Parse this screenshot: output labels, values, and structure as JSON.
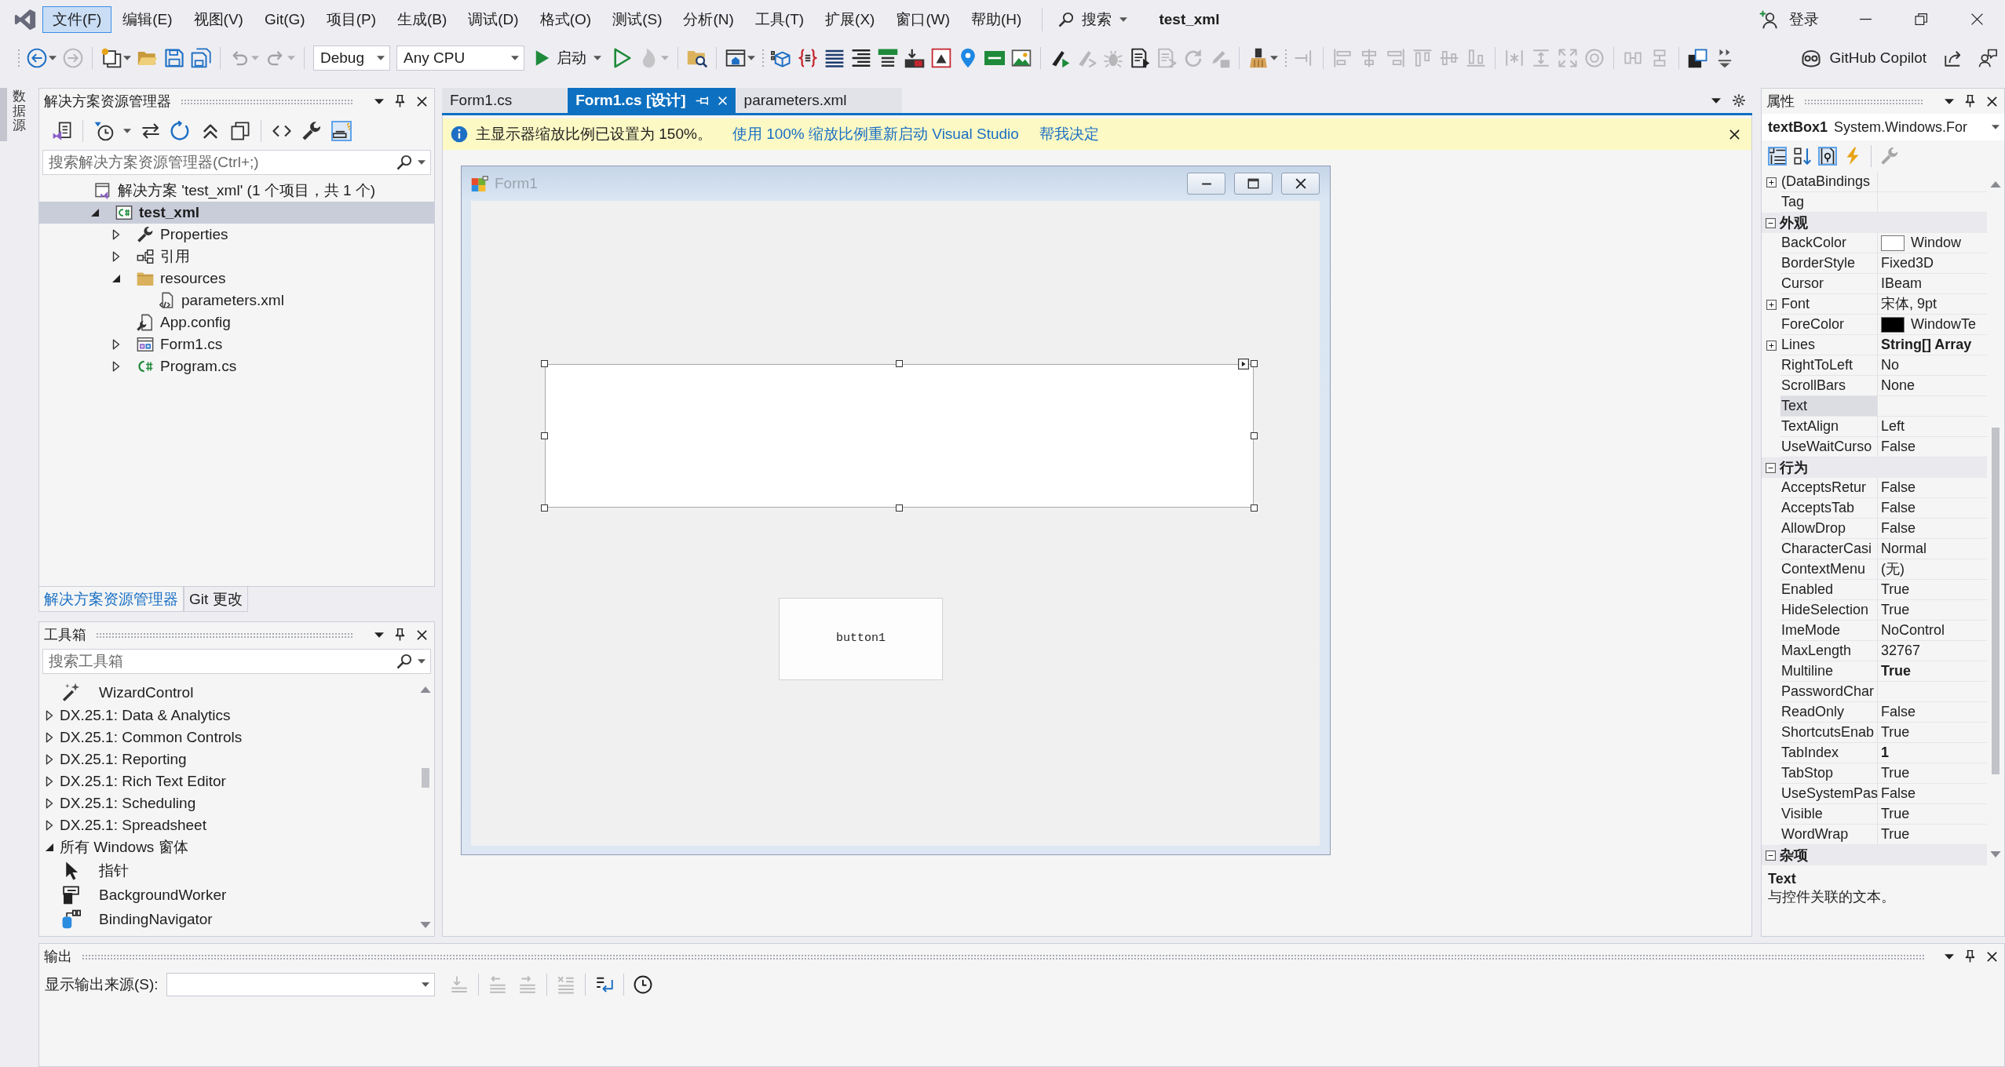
{
  "window": {
    "title": "test_xml",
    "search": "搜索",
    "sign_in": "登录"
  },
  "menu": [
    {
      "label": "文件(F)",
      "selected": true
    },
    {
      "label": "编辑(E)",
      "selected": false
    },
    {
      "label": "视图(V)",
      "selected": false
    },
    {
      "label": "Git(G)",
      "selected": false
    },
    {
      "label": "项目(P)",
      "selected": false
    },
    {
      "label": "生成(B)",
      "selected": false
    },
    {
      "label": "调试(D)",
      "selected": false
    },
    {
      "label": "格式(O)",
      "selected": false
    },
    {
      "label": "测试(S)",
      "selected": false
    },
    {
      "label": "分析(N)",
      "selected": false
    },
    {
      "label": "工具(T)",
      "selected": false
    },
    {
      "label": "扩展(X)",
      "selected": false
    },
    {
      "label": "窗口(W)",
      "selected": false
    },
    {
      "label": "帮助(H)",
      "selected": false
    }
  ],
  "toolbar": [
    {
      "kind": "grip"
    },
    {
      "kind": "back",
      "disabled": false,
      "caret": true
    },
    {
      "kind": "forward",
      "disabled": true
    },
    {
      "kind": "sep"
    },
    {
      "kind": "new-item",
      "disabled": false,
      "caret": true
    },
    {
      "kind": "open",
      "disabled": false
    },
    {
      "kind": "save",
      "disabled": false
    },
    {
      "kind": "save-all",
      "disabled": false
    },
    {
      "kind": "sep"
    },
    {
      "kind": "undo",
      "disabled": true,
      "caret": true
    },
    {
      "kind": "redo",
      "disabled": true,
      "caret": true
    },
    {
      "kind": "sep"
    },
    {
      "kind": "combo",
      "value": "Debug"
    },
    {
      "kind": "combo",
      "value": "Any CPU"
    },
    {
      "kind": "start",
      "label": "启动"
    },
    {
      "kind": "run",
      "disabled": false
    },
    {
      "kind": "hot-reload",
      "disabled": true,
      "caret": true
    },
    {
      "kind": "sep"
    },
    {
      "kind": "find",
      "disabled": false
    },
    {
      "kind": "sep"
    },
    {
      "kind": "layout",
      "disabled": false,
      "caret": true
    },
    {
      "kind": "grip"
    },
    {
      "kind": "cube",
      "disabled": false
    },
    {
      "kind": "braces",
      "disabled": false
    },
    {
      "kind": "list",
      "disabled": false
    },
    {
      "kind": "lines",
      "disabled": false
    },
    {
      "kind": "bars",
      "disabled": false
    },
    {
      "kind": "download",
      "disabled": false
    },
    {
      "kind": "frame",
      "disabled": false
    },
    {
      "kind": "pin",
      "disabled": false
    },
    {
      "kind": "tag",
      "disabled": false
    },
    {
      "kind": "image",
      "disabled": false
    },
    {
      "kind": "sep"
    },
    {
      "kind": "brush-play",
      "disabled": false
    },
    {
      "kind": "brush-step",
      "disabled": true
    },
    {
      "kind": "bug",
      "disabled": true
    },
    {
      "kind": "doc-run",
      "disabled": false
    },
    {
      "kind": "doc-step",
      "disabled": true
    },
    {
      "kind": "reload",
      "disabled": true
    },
    {
      "kind": "edit",
      "disabled": true
    },
    {
      "kind": "sep"
    },
    {
      "kind": "broom",
      "disabled": false,
      "caret": true
    },
    {
      "kind": "grip"
    },
    {
      "kind": "grid-align",
      "disabled": true
    },
    {
      "kind": "sep"
    },
    {
      "kind": "align-left",
      "disabled": true
    },
    {
      "kind": "align-center",
      "disabled": true
    },
    {
      "kind": "align-right",
      "disabled": true
    },
    {
      "kind": "align-top",
      "disabled": true
    },
    {
      "kind": "align-middle",
      "disabled": true
    },
    {
      "kind": "align-bottom",
      "disabled": true
    },
    {
      "kind": "sep"
    },
    {
      "kind": "equal-width",
      "disabled": true
    },
    {
      "kind": "equal-height",
      "disabled": true
    },
    {
      "kind": "fit-size",
      "disabled": true
    },
    {
      "kind": "zoom",
      "disabled": true
    },
    {
      "kind": "sep"
    },
    {
      "kind": "h-space",
      "disabled": true
    },
    {
      "kind": "v-space",
      "disabled": true
    },
    {
      "kind": "sep"
    },
    {
      "kind": "front",
      "disabled": false
    },
    {
      "kind": "overflow",
      "disabled": false
    }
  ],
  "copilot_button": {
    "label": "GitHub Copilot"
  },
  "side_tabs": [
    {
      "label": "数据源"
    }
  ],
  "solution_explorer": {
    "title": "解决方案资源管理器",
    "toolbar": [
      {
        "kind": "views",
        "selected": false
      },
      {
        "kind": "sep"
      },
      {
        "kind": "pending",
        "selected": false,
        "caret": true
      },
      {
        "kind": "sync",
        "selected": false
      },
      {
        "kind": "se-refresh",
        "selected": false
      },
      {
        "kind": "collapse",
        "selected": false
      },
      {
        "kind": "show-all",
        "selected": false
      },
      {
        "kind": "sep"
      },
      {
        "kind": "code",
        "selected": false
      },
      {
        "kind": "wrench",
        "selected": false
      },
      {
        "kind": "preview",
        "selected": true
      }
    ],
    "search": {
      "placeholder": "搜索解决方案资源管理器(Ctrl+;)"
    },
    "tree": [
      {
        "kind": "solution",
        "label": "解决方案 'test_xml' (1 个项目，共 1 个)",
        "selected": false,
        "children": [
          {
            "kind": "csharp-project",
            "label": "test_xml",
            "selected": true,
            "startup": true,
            "expanded": true,
            "children": [
              {
                "kind": "properties",
                "label": "Properties",
                "selected": false,
                "expanded": false
              },
              {
                "kind": "references",
                "label": "引用",
                "selected": false,
                "expanded": false
              },
              {
                "kind": "folder",
                "label": "resources",
                "selected": false,
                "expanded": true,
                "children": [
                  {
                    "kind": "xml",
                    "label": "parameters.xml",
                    "selected": false
                  }
                ]
              },
              {
                "kind": "config",
                "label": "App.config",
                "selected": false
              },
              {
                "kind": "form",
                "label": "Form1.cs",
                "selected": false,
                "expanded": false
              },
              {
                "kind": "csharp",
                "label": "Program.cs",
                "selected": false,
                "expanded": false
              }
            ]
          }
        ]
      }
    ],
    "tabs": [
      {
        "label": "解决方案资源管理器",
        "selected": true
      },
      {
        "label": "Git 更改",
        "selected": false
      }
    ]
  },
  "toolbox": {
    "title": "工具箱",
    "search": {
      "placeholder": "搜索工具箱"
    },
    "items": [
      {
        "kind": "wand",
        "label": "WizardControl"
      },
      {
        "kind": "group",
        "label": "DX.25.1: Data & Analytics",
        "expanded": false
      },
      {
        "kind": "group",
        "label": "DX.25.1: Common Controls",
        "expanded": false
      },
      {
        "kind": "group",
        "label": "DX.25.1: Reporting",
        "expanded": false
      },
      {
        "kind": "group",
        "label": "DX.25.1: Rich Text Editor",
        "expanded": false
      },
      {
        "kind": "group",
        "label": "DX.25.1: Scheduling",
        "expanded": false
      },
      {
        "kind": "group",
        "label": "DX.25.1: Spreadsheet",
        "expanded": false
      },
      {
        "kind": "group",
        "label": "所有 Windows 窗体",
        "expanded": true,
        "children": [
          {
            "kind": "pointer",
            "label": "指针"
          },
          {
            "kind": "worker",
            "label": "BackgroundWorker"
          },
          {
            "kind": "navigator",
            "label": "BindingNavigator"
          }
        ]
      }
    ]
  },
  "document": {
    "tabs": [
      {
        "label": "Form1.cs",
        "selected": false
      },
      {
        "label": "Form1.cs [设计]",
        "selected": true
      },
      {
        "label": "parameters.xml",
        "selected": false
      }
    ],
    "info_bar": {
      "message": "主显示器缩放比例已设置为 150%。",
      "links": [
        "使用 100% 缩放比例重新启动 Visual Studio",
        "帮我决定"
      ]
    },
    "form": {
      "title": "Form1",
      "controls": [
        {
          "kind": "textbox",
          "selected": true
        },
        {
          "kind": "button",
          "label": "button1",
          "selected": false
        }
      ]
    }
  },
  "properties": {
    "title": "属性",
    "object": "textBox1",
    "object_type": "System.Windows.For",
    "toolbar": [
      {
        "kind": "categorized",
        "selected": true,
        "disabled": false
      },
      {
        "kind": "alphabetical",
        "selected": false,
        "disabled": false
      },
      {
        "kind": "property-pages",
        "selected": true,
        "disabled": false
      },
      {
        "kind": "events",
        "selected": false,
        "disabled": false
      },
      {
        "kind": "sep"
      },
      {
        "kind": "pages",
        "selected": false,
        "disabled": true
      }
    ],
    "rows": [
      {
        "kind": "property",
        "name": "(DataBindings",
        "expanded": false,
        "selected": false
      },
      {
        "kind": "property",
        "name": "Tag",
        "selected": false
      },
      {
        "kind": "category",
        "name": "外观",
        "expanded": true,
        "selected": false
      },
      {
        "kind": "property",
        "name": "BackColor",
        "value": "Window",
        "color": "#ffffff",
        "selected": false,
        "modified": false
      },
      {
        "kind": "property",
        "name": "BorderStyle",
        "value": "Fixed3D",
        "selected": false,
        "modified": false
      },
      {
        "kind": "property",
        "name": "Cursor",
        "value": "IBeam",
        "selected": false,
        "modified": false
      },
      {
        "kind": "property",
        "name": "Font",
        "value": "宋体, 9pt",
        "expanded": false,
        "selected": false,
        "modified": false
      },
      {
        "kind": "property",
        "name": "ForeColor",
        "value": "WindowTe",
        "color": "#000000",
        "selected": false,
        "modified": false
      },
      {
        "kind": "property",
        "name": "Lines",
        "value": "String[] Array",
        "expanded": false,
        "selected": false,
        "modified": true
      },
      {
        "kind": "property",
        "name": "RightToLeft",
        "value": "No",
        "selected": false,
        "modified": false
      },
      {
        "kind": "property",
        "name": "ScrollBars",
        "value": "None",
        "selected": false,
        "modified": false
      },
      {
        "kind": "property",
        "name": "Text",
        "selected": true
      },
      {
        "kind": "property",
        "name": "TextAlign",
        "value": "Left",
        "selected": false,
        "modified": false
      },
      {
        "kind": "property",
        "name": "UseWaitCurso",
        "value": "False",
        "selected": false,
        "modified": false
      },
      {
        "kind": "category",
        "name": "行为",
        "expanded": true,
        "selected": false
      },
      {
        "kind": "property",
        "name": "AcceptsRetur",
        "value": "False",
        "selected": false,
        "modified": false
      },
      {
        "kind": "property",
        "name": "AcceptsTab",
        "value": "False",
        "selected": false,
        "modified": false
      },
      {
        "kind": "property",
        "name": "AllowDrop",
        "value": "False",
        "selected": false,
        "modified": false
      },
      {
        "kind": "property",
        "name": "CharacterCasi",
        "value": "Normal",
        "selected": false,
        "modified": false
      },
      {
        "kind": "property",
        "name": "ContextMenu",
        "value": "(无)",
        "selected": false,
        "modified": false
      },
      {
        "kind": "property",
        "name": "Enabled",
        "value": "True",
        "selected": false,
        "modified": false
      },
      {
        "kind": "property",
        "name": "HideSelection",
        "value": "True",
        "selected": false,
        "modified": false
      },
      {
        "kind": "property",
        "name": "ImeMode",
        "value": "NoControl",
        "selected": false,
        "modified": false
      },
      {
        "kind": "property",
        "name": "MaxLength",
        "value": "32767",
        "selected": false,
        "modified": false
      },
      {
        "kind": "property",
        "name": "Multiline",
        "value": "True",
        "selected": false,
        "modified": true
      },
      {
        "kind": "property",
        "name": "PasswordChar",
        "selected": false
      },
      {
        "kind": "property",
        "name": "ReadOnly",
        "value": "False",
        "selected": false,
        "modified": false
      },
      {
        "kind": "property",
        "name": "ShortcutsEnab",
        "value": "True",
        "selected": false,
        "modified": false
      },
      {
        "kind": "property",
        "name": "TabIndex",
        "value": "1",
        "selected": false,
        "modified": true
      },
      {
        "kind": "property",
        "name": "TabStop",
        "value": "True",
        "selected": false,
        "modified": false
      },
      {
        "kind": "property",
        "name": "UseSystemPas",
        "value": "False",
        "selected": false,
        "modified": false
      },
      {
        "kind": "property",
        "name": "Visible",
        "value": "True",
        "selected": false,
        "modified": false
      },
      {
        "kind": "property",
        "name": "WordWrap",
        "value": "True",
        "selected": false,
        "modified": false
      },
      {
        "kind": "category",
        "name": "杂项",
        "expanded": true,
        "selected": false
      }
    ],
    "description": {
      "title": "Text",
      "text": "与控件关联的文本。"
    }
  },
  "output": {
    "title": "输出",
    "source_label": "显示输出来源(S):",
    "toolbar": [
      {
        "kind": "o-find",
        "disabled": true
      },
      {
        "kind": "sep"
      },
      {
        "kind": "o-prev",
        "disabled": true
      },
      {
        "kind": "o-next",
        "disabled": true
      },
      {
        "kind": "sep"
      },
      {
        "kind": "o-clear",
        "disabled": true
      },
      {
        "kind": "sep"
      },
      {
        "kind": "o-wrap",
        "disabled": false
      },
      {
        "kind": "sep"
      },
      {
        "kind": "o-clock",
        "disabled": false
      }
    ]
  }
}
